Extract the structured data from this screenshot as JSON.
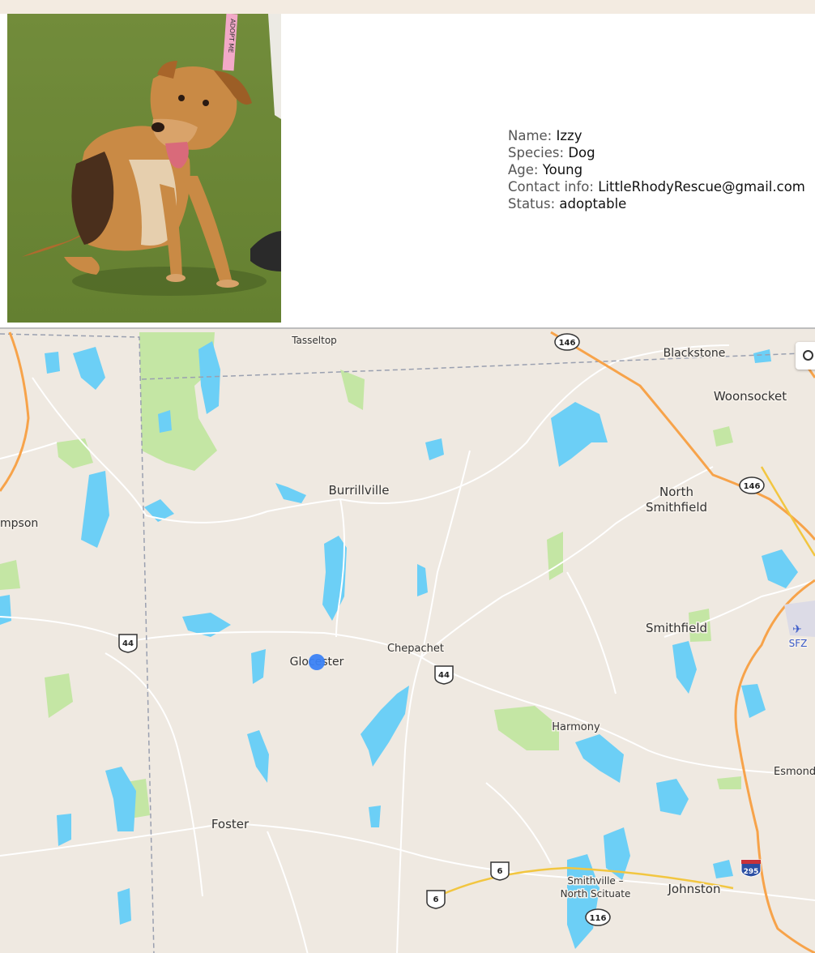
{
  "pet": {
    "collar_text": "ADOPT ME",
    "fields": [
      {
        "label": "Name:",
        "value": "Izzy"
      },
      {
        "label": "Species:",
        "value": "Dog"
      },
      {
        "label": "Age:",
        "value": "Young"
      },
      {
        "label": "Contact info:",
        "value": "LittleRhodyRescue@gmail.com"
      },
      {
        "label": "Status:",
        "value": "adoptable"
      }
    ]
  },
  "map": {
    "places": {
      "tasseltop": "Tasseltop",
      "blackstone": "Blackstone",
      "woonsocket": "Woonsocket",
      "burrillville": "Burrillville",
      "north": "North",
      "smithfield_n": "Smithfield",
      "thompson": "mpson",
      "smithfield": "Smithfield",
      "chepachet": "Chepachet",
      "glocester": "Glocester",
      "harmony": "Harmony",
      "esmond": "Esmond",
      "foster": "Foster",
      "smithville1": "Smithville –",
      "smithville2": "North Scituate",
      "johnston": "Johnston",
      "sfz": "SFZ"
    },
    "routes": {
      "r146a": "146",
      "r146b": "146",
      "r44a": "44",
      "r44b": "44",
      "r6a": "6",
      "r6b": "6",
      "r116": "116",
      "r295": "295"
    },
    "colors": {
      "land": "#efe9e1",
      "water": "#6ccff6",
      "park": "#c4e6a4",
      "highway": "#f7a34a",
      "state_line": "#9aa0b0",
      "marker": "#3b82f6"
    }
  }
}
